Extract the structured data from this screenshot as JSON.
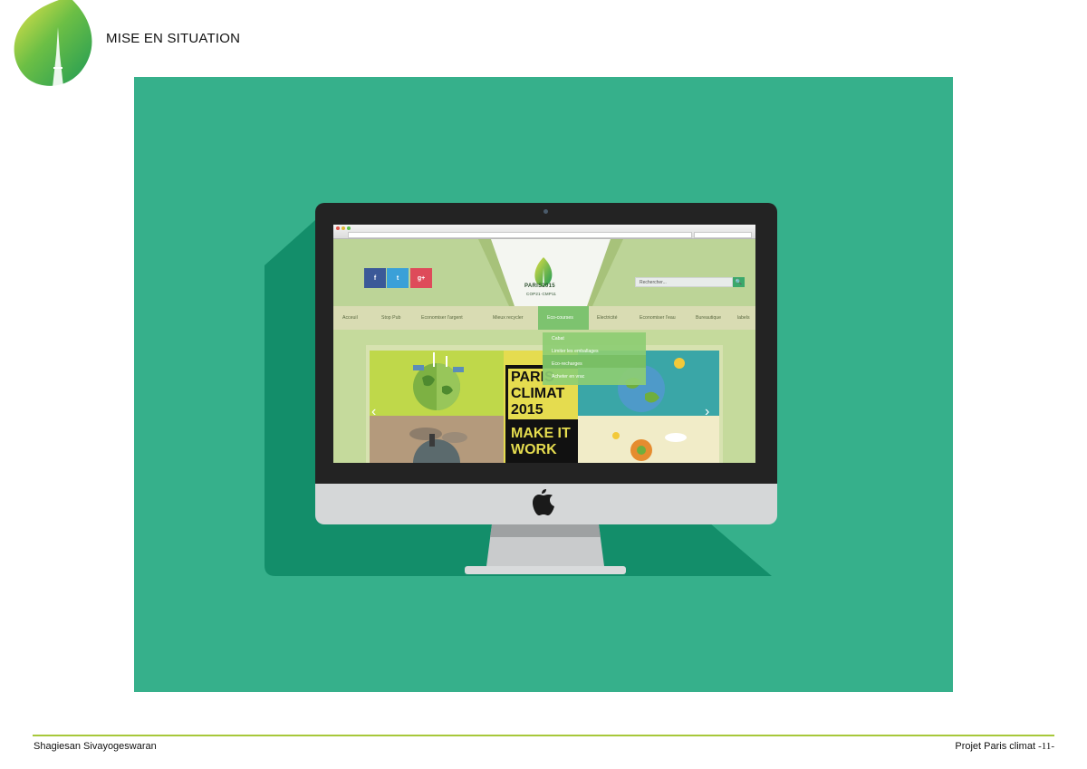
{
  "header": {
    "title": "MISE EN SITUATION"
  },
  "footer": {
    "author": "Shagiesan Sivayogeswaran",
    "project": "Projet Paris climat",
    "page": "-11-"
  },
  "colors": {
    "background": "#36b08b",
    "accent": "#a7c83a",
    "site_green": "#bcd497"
  },
  "website": {
    "social": [
      {
        "name": "facebook",
        "glyph": "f",
        "color": "#3b5998"
      },
      {
        "name": "twitter",
        "glyph": "t",
        "color": "#3aa0d8"
      },
      {
        "name": "google-plus",
        "glyph": "g+",
        "color": "#de4b5a"
      }
    ],
    "logo": {
      "main": "PARIS2015",
      "sub": "COP21·CMP11"
    },
    "search_placeholder": "Rechercher...",
    "nav": [
      "Acceuil",
      "Stop Pub",
      "Economiser l'argent",
      "Mieux recycler",
      "Eco-courses",
      "Electricité",
      "Economiser l'eau",
      "Bureautique",
      "labels"
    ],
    "active_nav": "Eco-courses",
    "dropdown": [
      "Cabat",
      "Limiter les emballages",
      "Eco-recharges",
      "Acheter en vrac"
    ],
    "banner": {
      "line1": "PARIS",
      "line2": "CLIMAT",
      "line3": "2015",
      "line4": "MAKE IT",
      "line5": "WORK"
    }
  }
}
